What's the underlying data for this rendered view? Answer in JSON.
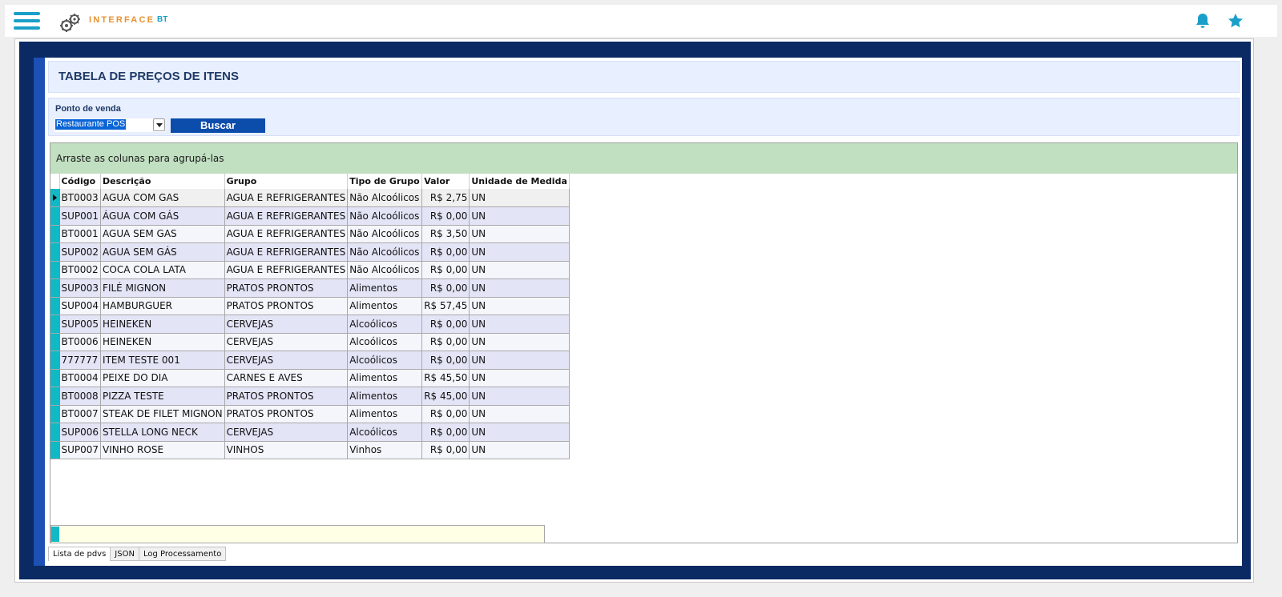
{
  "header": {
    "brand": "INTERFACE",
    "brand_suffix": "BT",
    "colors": {
      "accent": "#1a9fc9",
      "brand": "#e8912f"
    }
  },
  "page": {
    "title": "TABELA DE PREÇOS DE ITENS",
    "filter": {
      "label": "Ponto de venda",
      "selected_value": "Restaurante POS",
      "search_button": "Buscar"
    },
    "grid": {
      "group_hint": "Arraste as colunas para agrupá-las",
      "columns": [
        "Código",
        "Descrição",
        "Grupo",
        "Tipo de Grupo",
        "Valor",
        "Unidade de Medida"
      ],
      "rows": [
        [
          "BT0003",
          "AGUA COM GAS",
          "AGUA E REFRIGERANTES",
          "Não Alcoólicos",
          "R$ 2,75",
          "UN"
        ],
        [
          "SUP001",
          "ÁGUA COM GÁS",
          "AGUA E REFRIGERANTES",
          "Não Alcoólicos",
          "R$ 0,00",
          "UN"
        ],
        [
          "BT0001",
          "AGUA SEM GAS",
          "AGUA E REFRIGERANTES",
          "Não Alcoólicos",
          "R$ 3,50",
          "UN"
        ],
        [
          "SUP002",
          "AGUA SEM GÁS",
          "AGUA E REFRIGERANTES",
          "Não Alcoólicos",
          "R$ 0,00",
          "UN"
        ],
        [
          "BT0002",
          "COCA COLA LATA",
          "AGUA E REFRIGERANTES",
          "Não Alcoólicos",
          "R$ 0,00",
          "UN"
        ],
        [
          "SUP003",
          "FILÉ MIGNON",
          "PRATOS PRONTOS",
          "Alimentos",
          "R$ 0,00",
          "UN"
        ],
        [
          "SUP004",
          "HAMBURGUER",
          "PRATOS PRONTOS",
          "Alimentos",
          "R$ 57,45",
          "UN"
        ],
        [
          "SUP005",
          "HEINEKEN",
          "CERVEJAS",
          "Alcoólicos",
          "R$ 0,00",
          "UN"
        ],
        [
          "BT0006",
          "HEINEKEN",
          "CERVEJAS",
          "Alcoólicos",
          "R$ 0,00",
          "UN"
        ],
        [
          "777777",
          "ITEM TESTE 001",
          "CERVEJAS",
          "Alcoólicos",
          "R$ 0,00",
          "UN"
        ],
        [
          "BT0004",
          "PEIXE DO DIA",
          "CARNES E AVES",
          "Alimentos",
          "R$ 45,50",
          "UN"
        ],
        [
          "BT0008",
          "PIZZA TESTE",
          "PRATOS PRONTOS",
          "Alimentos",
          "R$ 45,00",
          "UN"
        ],
        [
          "BT0007",
          "STEAK DE FILET MIGNON",
          "PRATOS PRONTOS",
          "Alimentos",
          "R$ 0,00",
          "UN"
        ],
        [
          "SUP006",
          "STELLA LONG NECK",
          "CERVEJAS",
          "Alcoólicos",
          "R$ 0,00",
          "UN"
        ],
        [
          "SUP007",
          "VINHO ROSE",
          "VINHOS",
          "Vinhos",
          "R$ 0,00",
          "UN"
        ]
      ]
    },
    "tabs": [
      "Lista de pdvs",
      "JSON",
      "Log Processamento"
    ],
    "active_tab": "Lista de pdvs"
  },
  "icons": {
    "menu": "hamburger-menu-icon",
    "logo": "gears-icon",
    "notifications": "bell-icon",
    "favorites": "star-icon",
    "dropdown": "chevron-down-icon",
    "row_pointer": "row-pointer-icon"
  }
}
